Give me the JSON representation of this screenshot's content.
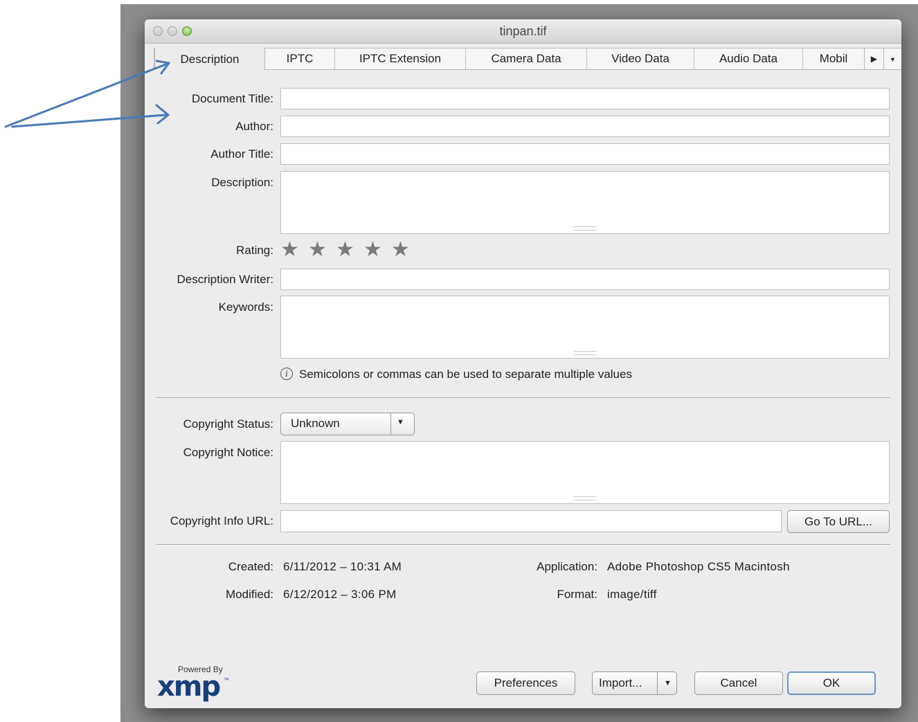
{
  "window": {
    "title": "tinpan.tif"
  },
  "tabs": [
    {
      "label": "Description",
      "active": true
    },
    {
      "label": "IPTC"
    },
    {
      "label": "IPTC Extension"
    },
    {
      "label": "Camera Data"
    },
    {
      "label": "Video Data"
    },
    {
      "label": "Audio Data"
    },
    {
      "label": "Mobil"
    }
  ],
  "tab_controls": {
    "scroll_right": "▶",
    "menu": "▼"
  },
  "form": {
    "document_title": {
      "label": "Document Title:",
      "value": ""
    },
    "author": {
      "label": "Author:",
      "value": ""
    },
    "author_title": {
      "label": "Author Title:",
      "value": ""
    },
    "description": {
      "label": "Description:",
      "value": ""
    },
    "rating": {
      "label": "Rating:",
      "stars": 5,
      "value": 0
    },
    "description_writer": {
      "label": "Description Writer:",
      "value": ""
    },
    "keywords": {
      "label": "Keywords:",
      "value": ""
    },
    "keywords_hint": "Semicolons or commas can be used to separate multiple values",
    "copyright_status": {
      "label": "Copyright Status:",
      "value": "Unknown"
    },
    "copyright_notice": {
      "label": "Copyright Notice:",
      "value": ""
    },
    "copyright_url": {
      "label": "Copyright Info URL:",
      "value": "",
      "button": "Go To URL..."
    }
  },
  "meta": {
    "created_label": "Created:",
    "created_value": "6/11/2012 – 10:31 AM",
    "modified_label": "Modified:",
    "modified_value": "6/12/2012 – 3:06 PM",
    "application_label": "Application:",
    "application_value": "Adobe Photoshop CS5 Macintosh",
    "format_label": "Format:",
    "format_value": "image/tiff"
  },
  "footer": {
    "powered_by": "Powered By",
    "logo_text": "xmp",
    "logo_tm": "™",
    "preferences": "Preferences",
    "import": "Import...",
    "cancel": "Cancel",
    "ok": "OK"
  },
  "colors": {
    "annotation_arrow": "#4a7ab8",
    "ok_border": "#6b97c8",
    "xmp_logo": "#17407a"
  },
  "icons": {
    "info": "info-icon",
    "star": "star-icon",
    "dropdown": "triangle-down-icon"
  }
}
